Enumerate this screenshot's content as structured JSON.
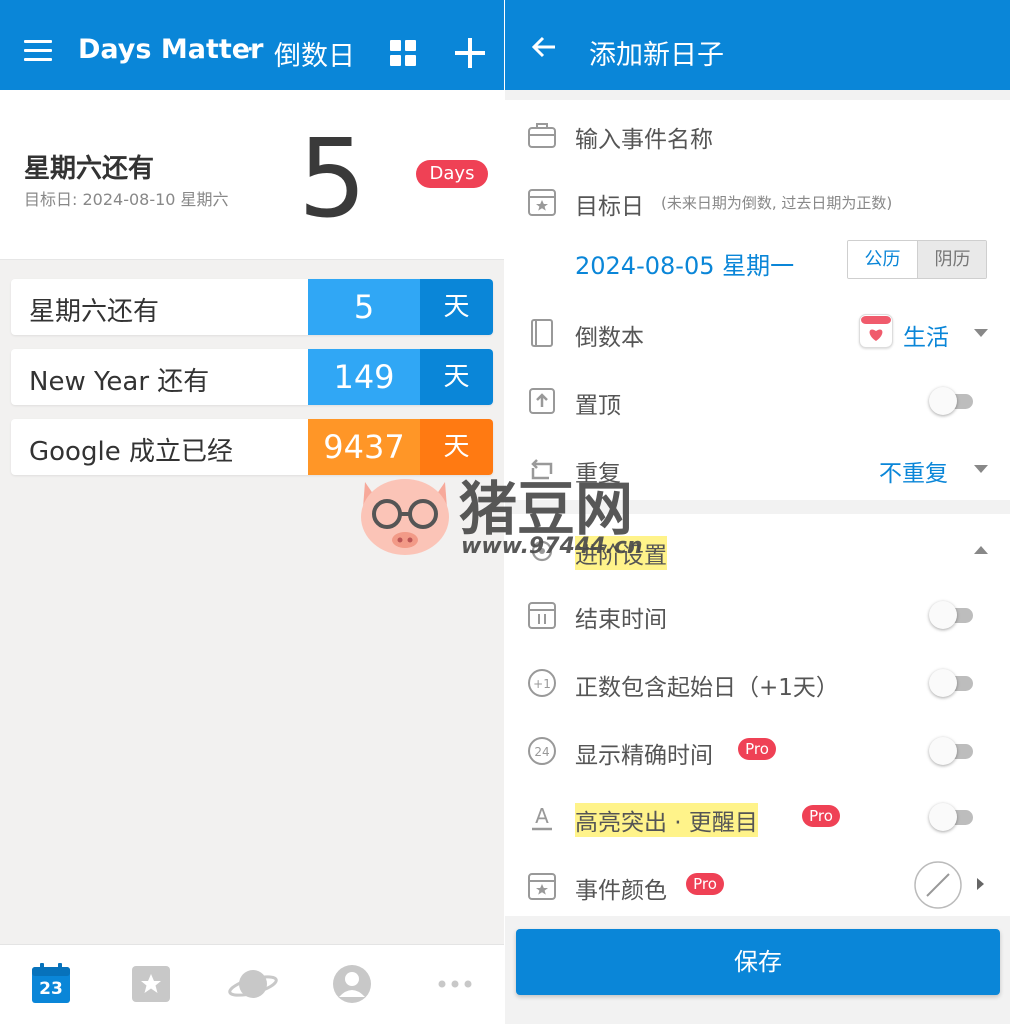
{
  "left": {
    "topbar": {
      "app_name": "Days Matter",
      "separator": "·",
      "section": "倒数日",
      "menu_icon": "hamburger-icon",
      "grid_icon": "grid-view-icon",
      "add_icon": "plus-icon"
    },
    "hero": {
      "title": "星期六还有",
      "target_date": "目标日: 2024-08-10 星期六",
      "days": "5",
      "badge": "Days"
    },
    "events": [
      {
        "name": "星期六还有",
        "days": "5",
        "unit": "天",
        "num_color": "#30a7f5",
        "unit_color": "#0a86d8"
      },
      {
        "name": "New Year 还有",
        "days": "149",
        "unit": "天",
        "num_color": "#30a7f5",
        "unit_color": "#0a86d8"
      },
      {
        "name": "Google 成立已经",
        "days": "9437",
        "unit": "天",
        "num_color": "#ff9627",
        "unit_color": "#ff7a12"
      }
    ],
    "bottom_nav": {
      "calendar_number": "23",
      "items": [
        "calendar-icon",
        "star-card-icon",
        "planet-icon",
        "profile-icon",
        "more-icon"
      ]
    }
  },
  "right": {
    "topbar": {
      "title": "添加新日子",
      "back_icon": "back-arrow-icon"
    },
    "name_placeholder": "输入事件名称",
    "target_day": {
      "label": "目标日",
      "hint": "(未来日期为倒数, 过去日期为正数)",
      "date": "2024-08-05 星期一",
      "calendar_solar": "公历",
      "calendar_lunar": "阴历"
    },
    "book": {
      "label": "倒数本",
      "value": "生活"
    },
    "pin": {
      "label": "置顶"
    },
    "repeat": {
      "label": "重复",
      "value": "不重复"
    },
    "advanced": {
      "label": "进阶设置"
    },
    "end_time": {
      "label": "结束时间"
    },
    "include_start": {
      "label": "正数包含起始日（+1天）"
    },
    "precise_time": {
      "label": "显示精确时间",
      "badge": "Pro"
    },
    "highlight": {
      "label": "高亮突出 · 更醒目",
      "badge": "Pro"
    },
    "event_color": {
      "label": "事件颜色",
      "badge": "Pro"
    },
    "save_label": "保存"
  },
  "watermark": {
    "name": "猪豆网",
    "url": "www.97444.cn"
  },
  "colors": {
    "primary": "#0a86d8",
    "accent_red": "#ef4155",
    "orange": "#ff7a12"
  }
}
